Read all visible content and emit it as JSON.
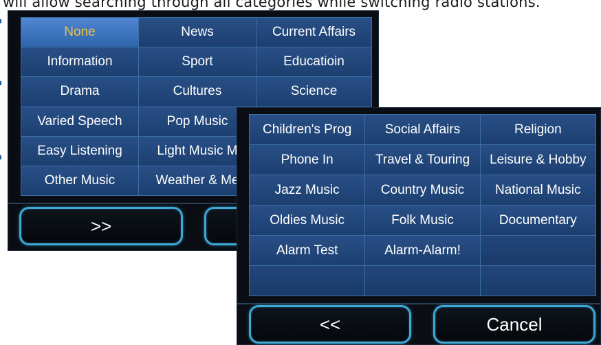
{
  "caption": "will allow searching through all categories while switching radio stations.",
  "panel1": {
    "categories": [
      "None",
      "News",
      "Current Affairs",
      "Information",
      "Sport",
      "Educatioin",
      "Drama",
      "Cultures",
      "Science",
      "Varied Speech",
      "Pop Music",
      "",
      "Easy Listening",
      "Light Music M",
      "",
      "Other Music",
      "Weather & Me",
      ""
    ],
    "selected": "None",
    "next_label": ">>",
    "second_button_label": ""
  },
  "panel2": {
    "categories": [
      "Children's Prog",
      "Social Affairs",
      "Religion",
      "Phone In",
      "Travel & Touring",
      "Leisure & Hobby",
      "Jazz Music",
      "Country Music",
      "National Music",
      "Oldies Music",
      "Folk Music",
      "Documentary",
      "Alarm Test",
      "Alarm-Alarm!",
      "",
      "",
      "",
      ""
    ],
    "prev_label": "<<",
    "cancel_label": "Cancel"
  },
  "colors": {
    "cell": "#224a80",
    "cell_selected": "#4279c4",
    "selected_text": "#f0c23e",
    "grid_line": "#3b6ea8",
    "button_border": "#3ea8d6",
    "panel_bg": "#0a0e14"
  }
}
